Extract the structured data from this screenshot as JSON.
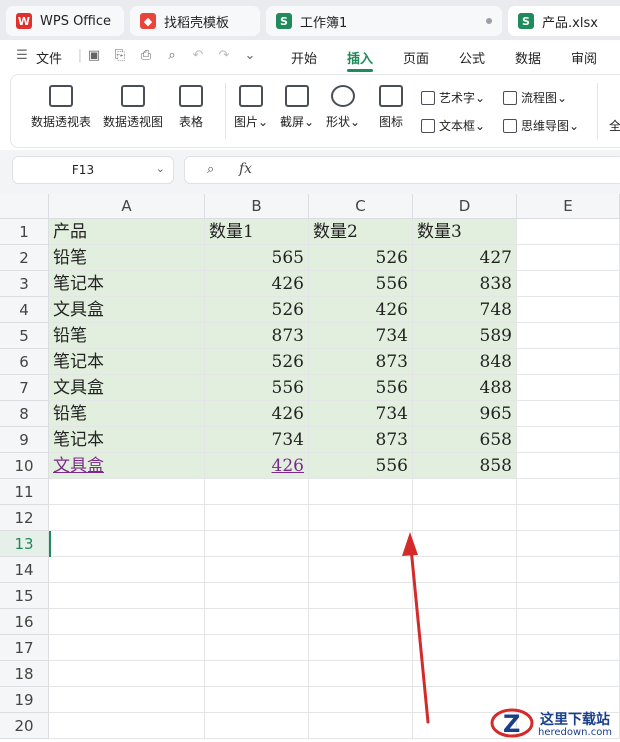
{
  "tabs": [
    {
      "label": "WPS Office",
      "icon": "wps-logo-icon",
      "icon_color": "#e0302e"
    },
    {
      "label": "找稻壳模板",
      "icon": "docer-icon",
      "icon_color": "#e8443a"
    },
    {
      "label": "工作簿1",
      "icon": "spreadsheet-icon",
      "icon_color": "#1f8a5a"
    },
    {
      "label": "产品.xlsx",
      "icon": "spreadsheet-icon",
      "icon_color": "#1f8a5a"
    }
  ],
  "menubar": {
    "file": "文件",
    "items": [
      "开始",
      "插入",
      "页面",
      "公式",
      "数据",
      "审阅"
    ],
    "active": "插入",
    "accent": "#1f8a5a"
  },
  "ribbon": {
    "pivot_table": "数据透视表",
    "pivot_chart": "数据透视图",
    "table": "表格",
    "picture": "图片",
    "screenshot": "截屏",
    "shape": "形状",
    "icon": "图标",
    "wordart": "艺术字",
    "textbox": "文本框",
    "flowchart": "流程图",
    "mindmap": "思维导图",
    "more": "全"
  },
  "formula_bar": {
    "name_box": "F13",
    "fx_label": "fx",
    "value": ""
  },
  "grid": {
    "columns": [
      "A",
      "B",
      "C",
      "D",
      "E"
    ],
    "rows": [
      "1",
      "2",
      "3",
      "4",
      "5",
      "6",
      "7",
      "8",
      "9",
      "10",
      "11",
      "12",
      "13",
      "14",
      "15",
      "16",
      "17",
      "18",
      "19",
      "20"
    ],
    "selected_row": "13",
    "fill_color": "#e2efdf",
    "header": [
      "产品",
      "数量1",
      "数量2",
      "数量3"
    ],
    "data": [
      [
        "铅笔",
        "565",
        "526",
        "427"
      ],
      [
        "笔记本",
        "426",
        "556",
        "838"
      ],
      [
        "文具盒",
        "526",
        "426",
        "748"
      ],
      [
        "铅笔",
        "873",
        "734",
        "589"
      ],
      [
        "笔记本",
        "526",
        "873",
        "848"
      ],
      [
        "文具盒",
        "556",
        "556",
        "488"
      ],
      [
        "铅笔",
        "426",
        "734",
        "965"
      ],
      [
        "笔记本",
        "734",
        "873",
        "658"
      ],
      [
        "文具盒",
        "426",
        "556",
        "858"
      ]
    ]
  },
  "watermark": {
    "title": "这里下载站",
    "url": "heredown.com"
  },
  "annotation_color": "#d42a2a"
}
